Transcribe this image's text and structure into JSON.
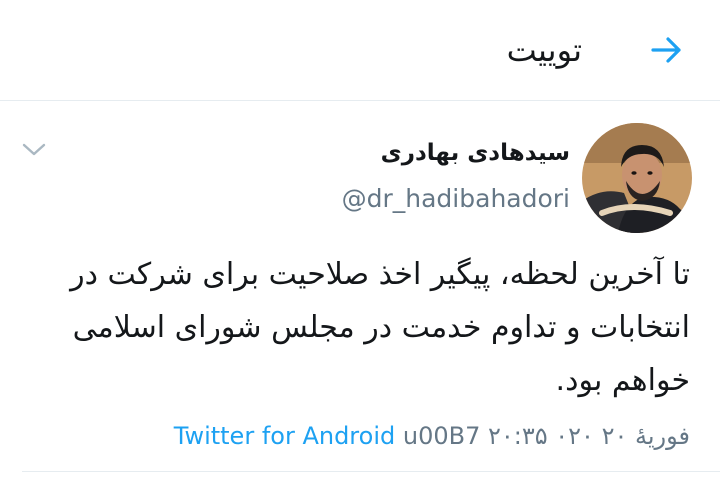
{
  "header": {
    "title": "توییت",
    "back_icon": "arrow-right-icon",
    "accent_color": "#1da1f2"
  },
  "tweet": {
    "author": {
      "display_name": "سیدهادی بهادری",
      "handle": "@dr_hadibahadori"
    },
    "text": "تا آخرین لحظه، پیگیر اخذ صلاحیت برای شرکت در انتخابات و تداوم خدمت در مجلس شورای اسلامی خواهم بود.",
    "timestamp": "۲۰:۳۵ ۰۲۰ فوریهٔ ۲۰",
    "separator": "u00B7",
    "source": "Twitter for Android",
    "caret_icon": "chevron-down-icon"
  }
}
